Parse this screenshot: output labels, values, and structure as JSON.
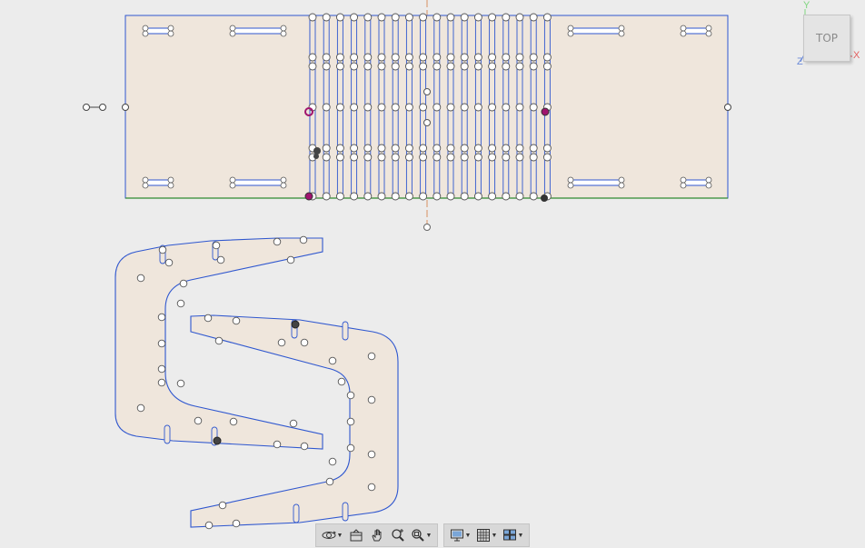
{
  "view": {
    "name": "TOP"
  },
  "axes": {
    "y": "Y",
    "x": "X",
    "z": "Z"
  },
  "colors": {
    "background": "#ececec",
    "sheet_fill": "#efe6dc",
    "profile_stroke": "#2f57cf",
    "bottom_edge": "#2f8a2f",
    "axis_x": "#e36060",
    "axis_y": "#7fd67f",
    "axis_z": "#6b8ad8",
    "center_line": "#d89060",
    "selected_point": "#a0146e"
  },
  "toolbar": {
    "orbit": {
      "icon": "orbit-icon"
    },
    "look_at": {
      "icon": "look-at-icon"
    },
    "pan": {
      "icon": "pan-hand-icon"
    },
    "zoom": {
      "icon": "zoom-icon"
    },
    "fit": {
      "icon": "fit-window-icon"
    },
    "display_settings": {
      "icon": "display-settings-icon"
    },
    "grid_settings": {
      "icon": "grid-icon"
    },
    "viewports": {
      "icon": "viewports-icon"
    }
  }
}
